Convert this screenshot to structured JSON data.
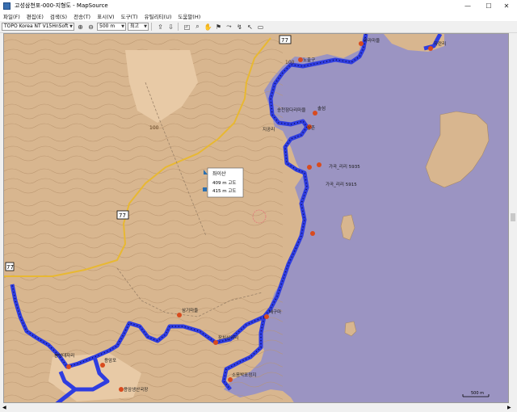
{
  "window": {
    "title": "고성삼천포-000-지형도 - MapSource",
    "minimize_icon": "minimize-icon",
    "maximize_icon": "maximize-icon",
    "close_icon": "close-icon"
  },
  "menu": [
    "파일(F)",
    "편집(E)",
    "검색(S)",
    "전송(T)",
    "표시(V)",
    "도구(T)",
    "유틸리티(U)",
    "도움말(H)"
  ],
  "toolbar": {
    "map_product": "TOPO Korea NT V15HnSoft",
    "zoom_scale": "500 m",
    "detail": "최고"
  },
  "map": {
    "road_label": "77",
    "road_label_2": "77",
    "road_label_3": "77",
    "elevation_label": "100",
    "elevation_label_2": "100",
    "popup": {
      "peak_name": "좌이산",
      "elev_1": "409 m 고도",
      "elev_2": "415 m 고도"
    },
    "wp_labels": [
      "노출구",
      "솔섬",
      "송천잠다리마을",
      "상촌",
      "지공리",
      "가곡_리리 5935",
      "가곡_리리 5915",
      "삼기마을",
      "장치산거리",
      "배구마",
      "소음박포정지",
      "봉성대자리",
      "용암포",
      "용암생산국장",
      "자란리",
      "아라마을"
    ],
    "scale_bar": "500 m"
  },
  "colors": {
    "land": "#d8b68f",
    "sea": "#9b94c2",
    "route": "#2f3de0",
    "road": "#e8b832"
  }
}
